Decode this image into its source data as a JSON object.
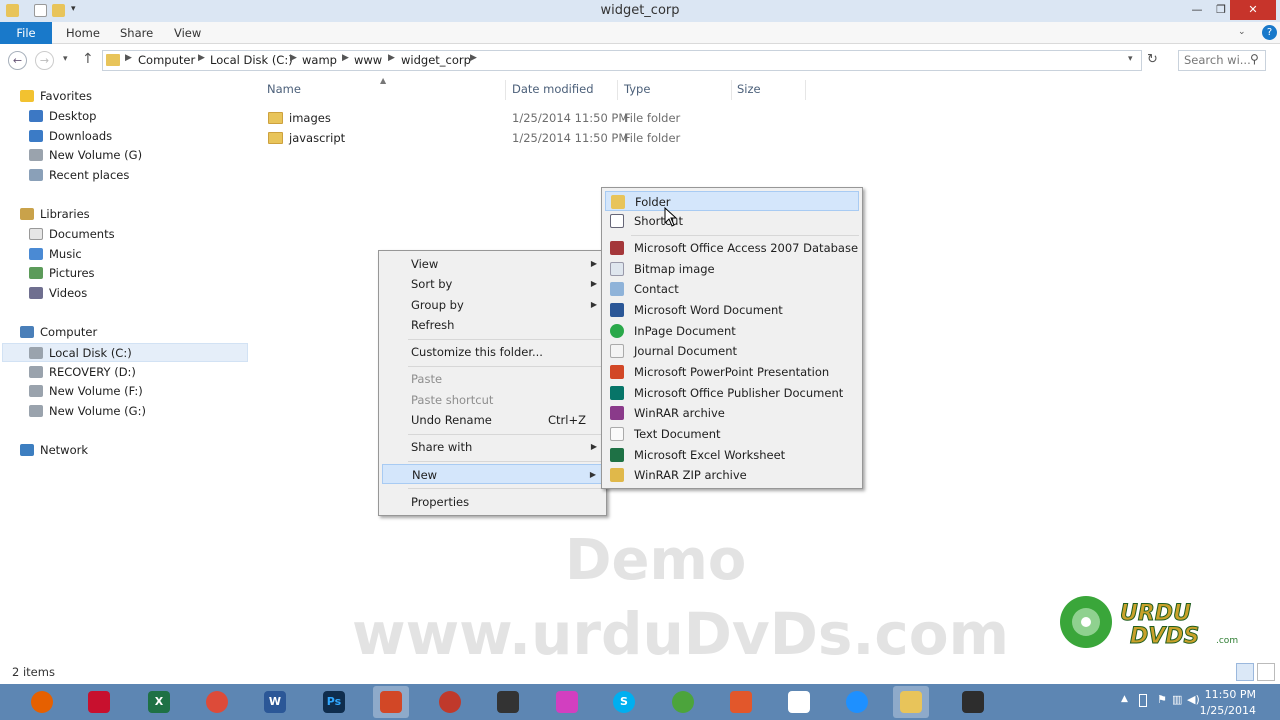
{
  "window": {
    "title": "widget_corp"
  },
  "ribbon": {
    "tabs": [
      "File",
      "Home",
      "Share",
      "View"
    ]
  },
  "address": {
    "crumbs": [
      "Computer",
      "Local Disk (C:)",
      "wamp",
      "www",
      "widget_corp"
    ],
    "search_placeholder": "Search wi..."
  },
  "nav": {
    "favorites": "Favorites",
    "desktop": "Desktop",
    "downloads": "Downloads",
    "new_volume_g1": "New Volume (G)",
    "recent": "Recent places",
    "libraries": "Libraries",
    "documents": "Documents",
    "music": "Music",
    "pictures": "Pictures",
    "videos": "Videos",
    "computer": "Computer",
    "local_disk": "Local Disk (C:)",
    "recovery": "RECOVERY (D:)",
    "new_volume_f": "New Volume (F:)",
    "new_volume_g2": "New Volume (G:)",
    "network": "Network"
  },
  "columns": {
    "name": "Name",
    "date": "Date modified",
    "type": "Type",
    "size": "Size"
  },
  "files": [
    {
      "name": "images",
      "date": "1/25/2014 11:50 PM",
      "type": "File folder"
    },
    {
      "name": "javascript",
      "date": "1/25/2014 11:50 PM",
      "type": "File folder"
    }
  ],
  "context_menu": {
    "view": "View",
    "sort_by": "Sort by",
    "group_by": "Group by",
    "refresh": "Refresh",
    "customize": "Customize this folder...",
    "paste": "Paste",
    "paste_shortcut": "Paste shortcut",
    "undo_rename": "Undo Rename",
    "undo_shortcut": "Ctrl+Z",
    "share_with": "Share with",
    "new": "New",
    "properties": "Properties"
  },
  "new_submenu": {
    "folder": "Folder",
    "shortcut": "Shortcut",
    "access": "Microsoft Office Access 2007 Database",
    "bitmap": "Bitmap image",
    "contact": "Contact",
    "word": "Microsoft Word Document",
    "inpage": "InPage Document",
    "journal": "Journal Document",
    "powerpoint": "Microsoft PowerPoint Presentation",
    "publisher": "Microsoft Office Publisher Document",
    "winrar": "WinRAR archive",
    "text": "Text Document",
    "excel": "Microsoft Excel Worksheet",
    "winrar_zip": "WinRAR ZIP archive"
  },
  "watermark": {
    "demo": "Demo",
    "url": "www.urduDvDs.com",
    "logo_text": "URDU DVDS.com"
  },
  "status": {
    "items": "2 items"
  },
  "clock": {
    "time": "11:50 PM",
    "date": "1/25/2014"
  },
  "colors": {
    "accent": "#1979ca",
    "taskbar": "#5d86b3",
    "highlight": "#d4e6fb"
  }
}
